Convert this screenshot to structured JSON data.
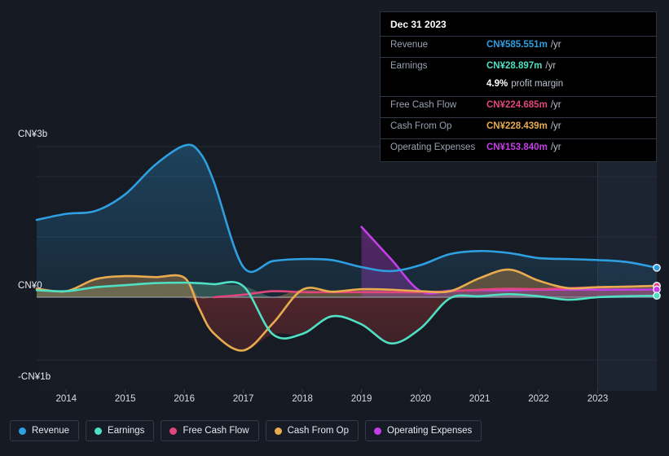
{
  "colors": {
    "revenue": "#2e9fe0",
    "earnings": "#4fe0c4",
    "free_cash_flow": "#e0467c",
    "cash_from_op": "#e8ab4e",
    "operating_expenses": "#c43fe8",
    "background": "#151a23",
    "gridline": "#272c38",
    "zero_line": "#9aa2b1",
    "tooltip_bg": "#000000"
  },
  "tooltip": {
    "date": "Dec 31 2023",
    "rows": [
      {
        "label": "Revenue",
        "value": "CN¥585.551m",
        "unit": "/yr",
        "color": "#2e9fe0"
      },
      {
        "label": "Earnings",
        "value": "CN¥28.897m",
        "unit": "/yr",
        "color": "#4fe0c4"
      },
      {
        "label": "",
        "value": "4.9%",
        "unit": "profit margin",
        "color": "#ffffff",
        "sub": true
      },
      {
        "label": "Free Cash Flow",
        "value": "CN¥224.685m",
        "unit": "/yr",
        "color": "#e0467c"
      },
      {
        "label": "Cash From Op",
        "value": "CN¥228.439m",
        "unit": "/yr",
        "color": "#e8ab4e"
      },
      {
        "label": "Operating Expenses",
        "value": "CN¥153.840m",
        "unit": "/yr",
        "color": "#c43fe8"
      }
    ]
  },
  "legend": {
    "items": [
      {
        "label": "Revenue",
        "color": "#2e9fe0"
      },
      {
        "label": "Earnings",
        "color": "#4fe0c4"
      },
      {
        "label": "Free Cash Flow",
        "color": "#e0467c"
      },
      {
        "label": "Cash From Op",
        "color": "#e8ab4e"
      },
      {
        "label": "Operating Expenses",
        "color": "#c43fe8"
      }
    ]
  },
  "chart_data": {
    "type": "area",
    "title": "",
    "xlabel": "",
    "ylabel": "",
    "currency": "CN¥",
    "x_tick_labels": [
      "2014",
      "2015",
      "2016",
      "2017",
      "2018",
      "2019",
      "2020",
      "2021",
      "2022",
      "2023"
    ],
    "y_tick_labels": [
      "CN¥3b",
      "CN¥0",
      "-CN¥1b"
    ],
    "ylim": [
      -1.35,
      3.35
    ],
    "grid": true,
    "legend_position": "bottom",
    "forecast_region_starts": "2023",
    "x": [
      2013.5,
      2014,
      2014.5,
      2015,
      2015.5,
      2016,
      2016.25,
      2016.5,
      2017,
      2017.5,
      2018,
      2018.5,
      2019,
      2019.5,
      2020,
      2020.5,
      2021,
      2021.5,
      2022,
      2022.5,
      2023,
      2023.5,
      2024
    ],
    "series": [
      {
        "name": "Revenue",
        "color": "#2e9fe0",
        "units": "b",
        "values": [
          1.54,
          1.66,
          1.72,
          2.05,
          2.63,
          3.02,
          2.9,
          2.3,
          0.6,
          0.72,
          0.76,
          0.74,
          0.6,
          0.52,
          0.64,
          0.86,
          0.92,
          0.88,
          0.78,
          0.76,
          0.74,
          0.7,
          0.586
        ]
      },
      {
        "name": "Earnings",
        "color": "#4fe0c4",
        "units": "b",
        "values": [
          0.14,
          0.12,
          0.2,
          0.24,
          0.28,
          0.29,
          0.28,
          0.26,
          0.22,
          -0.74,
          -0.73,
          -0.38,
          -0.54,
          -0.92,
          -0.62,
          -0.02,
          0.02,
          0.06,
          0.02,
          -0.05,
          0.0,
          0.02,
          0.029
        ]
      },
      {
        "name": "Free Cash Flow",
        "color": "#e0467c",
        "units": "b",
        "values": [
          null,
          null,
          null,
          null,
          null,
          null,
          null,
          0.0,
          0.05,
          0.12,
          0.1,
          0.1,
          0.1,
          0.1,
          0.1,
          0.12,
          0.15,
          0.17,
          0.16,
          0.18,
          0.2,
          0.21,
          0.225
        ]
      },
      {
        "name": "Cash From Op",
        "color": "#e8ab4e",
        "units": "b",
        "values": [
          0.17,
          0.12,
          0.36,
          0.42,
          0.4,
          0.39,
          -0.22,
          -0.72,
          -1.06,
          -0.52,
          0.15,
          0.11,
          0.16,
          0.15,
          0.12,
          0.12,
          0.38,
          0.55,
          0.33,
          0.18,
          0.2,
          0.21,
          0.228
        ]
      },
      {
        "name": "Operating Expenses",
        "color": "#c43fe8",
        "units": "b",
        "values": [
          null,
          null,
          null,
          null,
          null,
          null,
          null,
          null,
          null,
          null,
          null,
          null,
          1.4,
          0.76,
          0.12,
          0.13,
          0.14,
          0.14,
          0.15,
          0.15,
          0.15,
          0.15,
          0.154
        ]
      }
    ],
    "last_point_markers": [
      {
        "name": "Revenue",
        "value": 0.586
      },
      {
        "name": "Cash From Op",
        "value": 0.228
      },
      {
        "name": "Free Cash Flow",
        "value": 0.225
      },
      {
        "name": "Operating Expenses",
        "value": 0.154
      },
      {
        "name": "Earnings",
        "value": 0.029
      }
    ]
  }
}
